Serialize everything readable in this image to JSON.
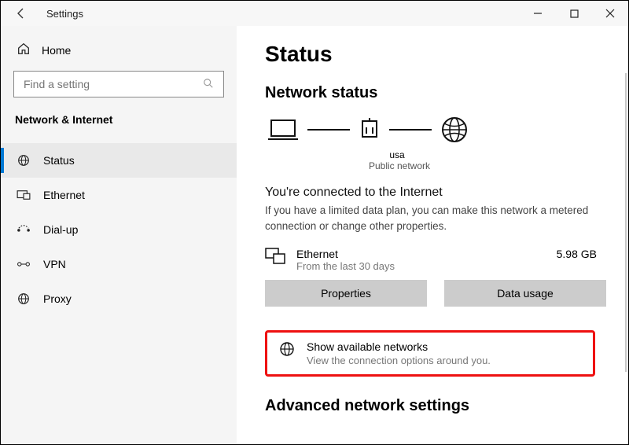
{
  "window": {
    "title": "Settings"
  },
  "sidebar": {
    "home_label": "Home",
    "search_placeholder": "Find a setting",
    "category": "Network & Internet",
    "items": [
      {
        "label": "Status"
      },
      {
        "label": "Ethernet"
      },
      {
        "label": "Dial-up"
      },
      {
        "label": "VPN"
      },
      {
        "label": "Proxy"
      }
    ]
  },
  "content": {
    "page_title": "Status",
    "section_title": "Network status",
    "diagram": {
      "conn_name": "usa",
      "conn_type": "Public network"
    },
    "connected_heading": "You're connected to the Internet",
    "connected_message": "If you have a limited data plan, you can make this network a metered connection or change other properties.",
    "adapter": {
      "name": "Ethernet",
      "sub": "From the last 30 days",
      "usage": "5.98 GB"
    },
    "buttons": {
      "properties": "Properties",
      "data_usage": "Data usage"
    },
    "show_available": {
      "title": "Show available networks",
      "desc": "View the connection options around you."
    },
    "advanced_heading": "Advanced network settings"
  }
}
